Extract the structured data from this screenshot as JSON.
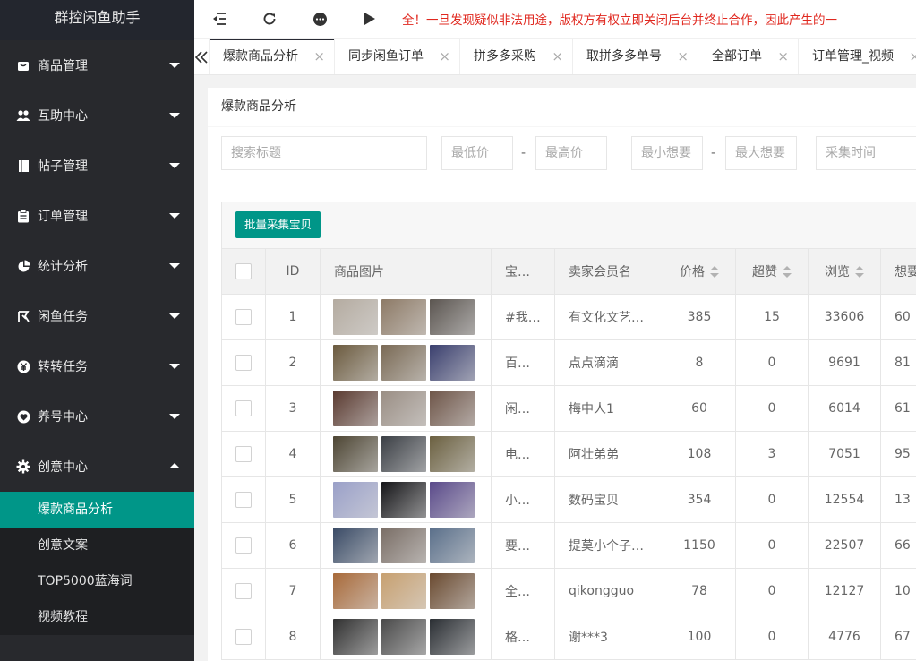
{
  "app": {
    "title": "群控闲鱼助手"
  },
  "sidebar": {
    "items": [
      {
        "label": "商品管理",
        "icon": "bag-icon"
      },
      {
        "label": "互助中心",
        "icon": "users-icon"
      },
      {
        "label": "帖子管理",
        "icon": "book-icon"
      },
      {
        "label": "订单管理",
        "icon": "clipboard-icon"
      },
      {
        "label": "统计分析",
        "icon": "pie-chart-icon"
      },
      {
        "label": "闲鱼任务",
        "icon": "fish-icon"
      },
      {
        "label": "转转任务",
        "icon": "yuan-icon"
      },
      {
        "label": "养号中心",
        "icon": "heart-icon"
      },
      {
        "label": "创意中心",
        "icon": "gear-icon"
      }
    ],
    "submenu": [
      "爆款商品分析",
      "创意文案",
      "TOP5000蓝海词",
      "视频教程"
    ]
  },
  "topbar": {
    "notice": "全！一旦发现疑似非法用途，版权方有权立即关闭后台并终止合作，因此产生的一"
  },
  "tabs": [
    {
      "label": "爆款商品分析"
    },
    {
      "label": "同步闲鱼订单"
    },
    {
      "label": "拼多多采购"
    },
    {
      "label": "取拼多多单号"
    },
    {
      "label": "全部订单"
    },
    {
      "label": "订单管理_视频"
    }
  ],
  "page": {
    "title": "爆款商品分析"
  },
  "filters": {
    "search": "搜索标题",
    "min_price": "最低价",
    "max_price": "最高价",
    "min_want": "最小想要",
    "max_want": "最大想要",
    "collect_time": "采集时间",
    "dash": "-"
  },
  "toolbar": {
    "batch_button": "批量采集宝贝"
  },
  "table": {
    "columns": [
      "ID",
      "商品图片",
      "宝…",
      "卖家会员名",
      "价格",
      "超赞",
      "浏览",
      "想要"
    ],
    "rows": [
      {
        "id": "1",
        "title": "#我…",
        "seller": "有文化文艺…",
        "price": "385",
        "likes": "15",
        "views": "33606",
        "want": "60",
        "colors": [
          "#b4aba0",
          "#8d7a66",
          "#5b5550"
        ]
      },
      {
        "id": "2",
        "title": "百…",
        "seller": "点点滴滴",
        "price": "8",
        "likes": "0",
        "views": "9691",
        "want": "81",
        "colors": [
          "#6b5a3e",
          "#7a6a55",
          "#3a3f6e"
        ]
      },
      {
        "id": "3",
        "title": "闲…",
        "seller": "梅中人1",
        "price": "60",
        "likes": "0",
        "views": "6014",
        "want": "61",
        "colors": [
          "#5a3a30",
          "#9a8e84",
          "#6e5548"
        ]
      },
      {
        "id": "4",
        "title": "电…",
        "seller": "阿壮弟弟",
        "price": "108",
        "likes": "3",
        "views": "7051",
        "want": "95",
        "colors": [
          "#4d4533",
          "#3b3f45",
          "#6b6040"
        ]
      },
      {
        "id": "5",
        "title": "小…",
        "seller": "数码宝贝",
        "price": "354",
        "likes": "0",
        "views": "12554",
        "want": "13",
        "colors": [
          "#9aa0c8",
          "#151518",
          "#5a4a8a"
        ]
      },
      {
        "id": "6",
        "title": "要…",
        "seller": "提莫小个子…",
        "price": "1150",
        "likes": "0",
        "views": "22507",
        "want": "66",
        "colors": [
          "#3a4b66",
          "#7a6e66",
          "#5a6f8a"
        ]
      },
      {
        "id": "7",
        "title": "全…",
        "seller": "qikongguo",
        "price": "78",
        "likes": "0",
        "views": "12127",
        "want": "10",
        "colors": [
          "#a86a3a",
          "#c7a070",
          "#6a4a30"
        ]
      },
      {
        "id": "8",
        "title": "格…",
        "seller": "谢***3",
        "price": "100",
        "likes": "0",
        "views": "4776",
        "want": "67",
        "colors": [
          "#303030",
          "#4a4a4a",
          "#2a2e33"
        ]
      }
    ]
  }
}
